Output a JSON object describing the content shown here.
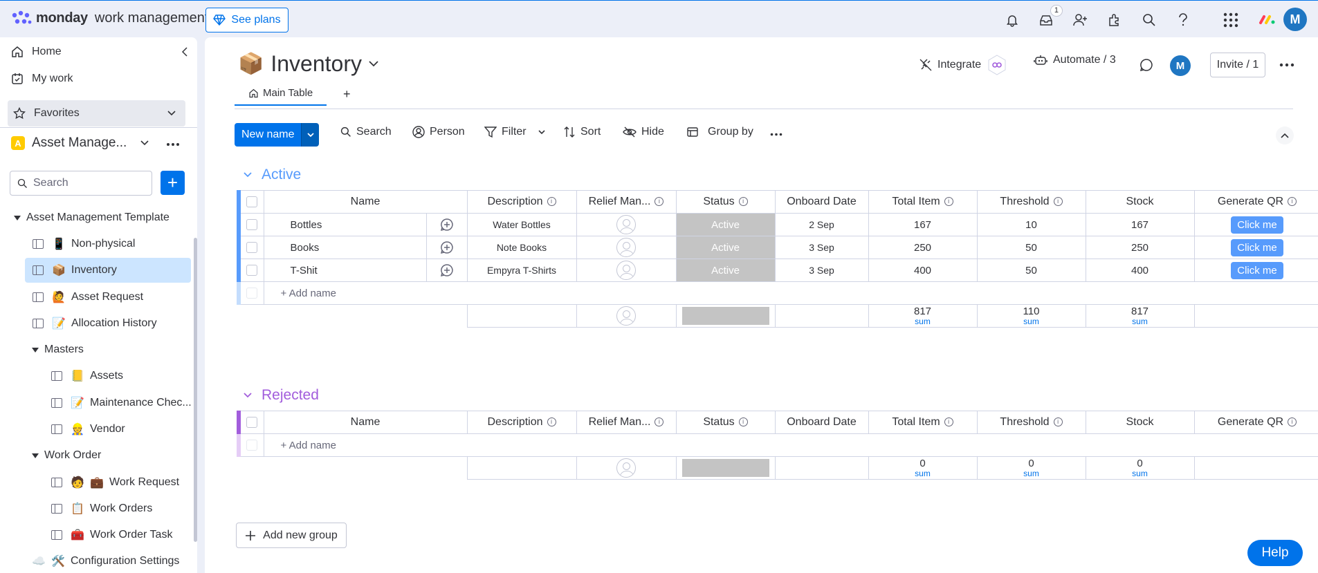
{
  "topbar": {
    "brand": "monday",
    "product": "work management",
    "see_plans": "See plans",
    "inbox_badge": "1",
    "user_initial": "M"
  },
  "sidebar": {
    "home": "Home",
    "my_work": "My work",
    "favorites": "Favorites",
    "workspace_initial": "A",
    "workspace_name": "Asset Manage...",
    "search_placeholder": "Search",
    "tree": {
      "root": "Asset Management Template",
      "non_physical": "Non-physical",
      "inventory": "Inventory",
      "asset_request": "Asset Request",
      "allocation_history": "Allocation History",
      "masters": "Masters",
      "assets": "Assets",
      "maintenance": "Maintenance Chec...",
      "vendor": "Vendor",
      "work_order": "Work Order",
      "work_request": "Work Request",
      "work_orders": "Work Orders",
      "work_order_task": "Work Order Task",
      "configuration": "Configuration Settings"
    }
  },
  "board": {
    "title": "Inventory",
    "tab_main": "Main Table",
    "integrate": "Integrate",
    "automate": "Automate / 3",
    "avatar": "M",
    "invite": "Invite / 1",
    "new_item": "New name",
    "toolbar": {
      "search": "Search",
      "person": "Person",
      "filter": "Filter",
      "sort": "Sort",
      "hide": "Hide",
      "group_by": "Group by"
    },
    "columns": [
      "Name",
      "Description",
      "Relief Man...",
      "Status",
      "Onboard Date",
      "Total Item",
      "Threshold",
      "Stock",
      "Generate QR"
    ],
    "groups": [
      {
        "title": "Active",
        "color": "#579bfc",
        "rows": [
          {
            "name": "Bottles",
            "description": "Water Bottles",
            "status": "Active",
            "date": "2 Sep",
            "total": "167",
            "threshold": "10",
            "stock": "167",
            "qr": "Click me"
          },
          {
            "name": "Books",
            "description": "Note Books",
            "status": "Active",
            "date": "3 Sep",
            "total": "250",
            "threshold": "50",
            "stock": "250",
            "qr": "Click me"
          },
          {
            "name": "T-Shit",
            "description": "Empyra T-Shirts",
            "status": "Active",
            "date": "3 Sep",
            "total": "400",
            "threshold": "50",
            "stock": "400",
            "qr": "Click me"
          }
        ],
        "add_item": "+ Add name",
        "summary": {
          "total": "817",
          "threshold": "110",
          "stock": "817",
          "label": "sum"
        }
      },
      {
        "title": "Rejected",
        "color": "#a25ddc",
        "rows": [],
        "add_item": "+ Add name",
        "summary": {
          "total": "0",
          "threshold": "0",
          "stock": "0",
          "label": "sum"
        }
      }
    ],
    "add_group": "Add new group",
    "help": "Help"
  }
}
